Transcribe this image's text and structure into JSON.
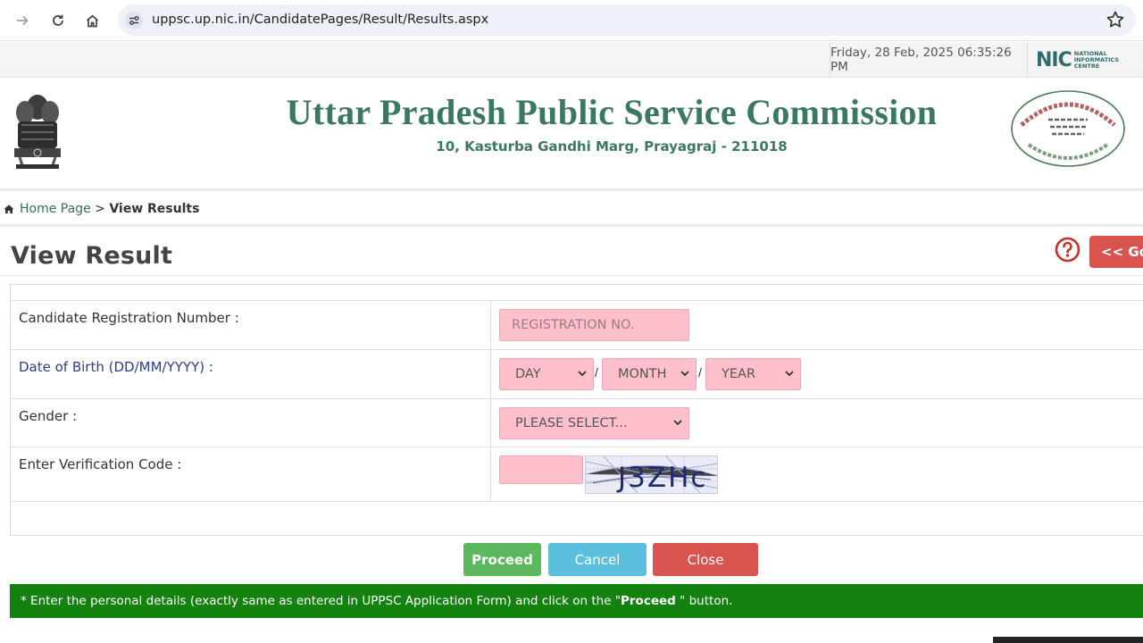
{
  "browser": {
    "url": "uppsc.up.nic.in/CandidatePages/Result/Results.aspx"
  },
  "topbar": {
    "datetime": "Friday, 28 Feb, 2025 06:35:26 PM",
    "nic_logo": {
      "big": "NIC",
      "line1": "NATIONAL",
      "line2": "INFORMATICS",
      "line3": "CENTRE"
    }
  },
  "header": {
    "title": "Uttar Pradesh Public Service Commission",
    "address": "10, Kasturba Gandhi Marg, Prayagraj - 211018",
    "emblem_caption": "सत्यमेव जयते"
  },
  "breadcrumb": {
    "home": "Home Page",
    "separator": " > ",
    "current": "View Results"
  },
  "page": {
    "title": "View Result",
    "go_back_label": "<< Go Back"
  },
  "form": {
    "registration": {
      "label": "Candidate Registration Number :",
      "placeholder": "REGISTRATION NO."
    },
    "dob": {
      "label": "Date of Birth (DD/MM/YYYY) :",
      "day": "DAY",
      "month": "MONTH",
      "year": "YEAR",
      "separator": "/"
    },
    "gender": {
      "label": "Gender :",
      "selected": "PLEASE SELECT..."
    },
    "captcha": {
      "label": "Enter Verification Code :",
      "code": "J3ZHc"
    }
  },
  "buttons": {
    "proceed": "Proceed",
    "cancel": "Cancel",
    "close": "Close"
  },
  "note": {
    "prefix": "* Enter the personal details (exactly same as entered in UPPSC Application Form) and click on the \"",
    "emphasis": "Proceed",
    "suffix": " \" button."
  },
  "colors": {
    "brand_green": "#3a7764",
    "input_pink": "#ffc0cb",
    "proceed_green": "#5cb85c",
    "cancel_blue": "#5bc0de",
    "close_red": "#d9534f",
    "note_green": "#14820f"
  }
}
